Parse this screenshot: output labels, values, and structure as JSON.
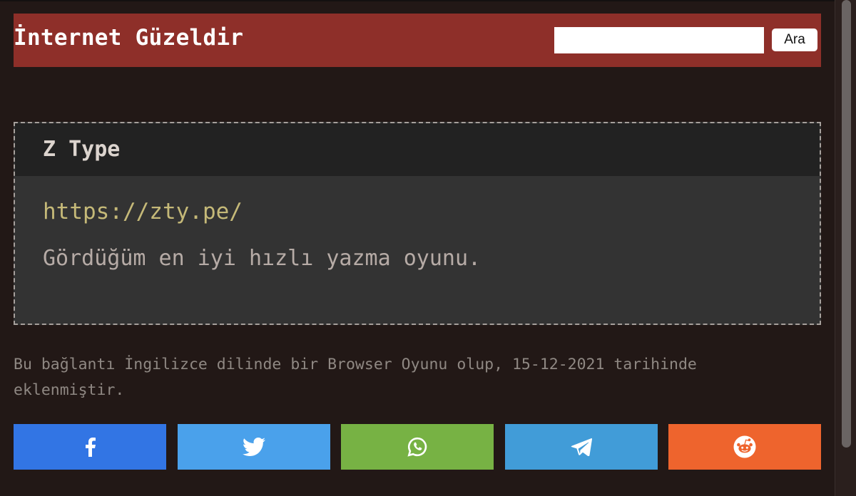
{
  "header": {
    "site_title": "İnternet Güzeldir",
    "search_value": "",
    "search_button_label": "Ara"
  },
  "entry": {
    "title": "Z Type",
    "url": "https://zty.pe/",
    "description": "Gördüğüm en iyi hızlı yazma oyunu.",
    "meta_text": "Bu bağlantı İngilizce dilinde bir Browser Oyunu olup, 15-12-2021 tarihinde eklenmiştir."
  },
  "share_buttons": [
    {
      "network": "facebook",
      "icon": "facebook-icon",
      "color": "#3275e4"
    },
    {
      "network": "twitter",
      "icon": "twitter-icon",
      "color": "#4aa1eb"
    },
    {
      "network": "whatsapp",
      "icon": "whatsapp-icon",
      "color": "#77b244"
    },
    {
      "network": "telegram",
      "icon": "telegram-icon",
      "color": "#419cd8"
    },
    {
      "network": "reddit",
      "icon": "reddit-icon",
      "color": "#ee642d"
    }
  ],
  "colors": {
    "page_background": "#221816",
    "header_background": "#8e2f29",
    "card_background": "#333333",
    "card_head_background": "#222222",
    "link_color": "#c5b978",
    "meta_text_color": "#8f8883"
  }
}
